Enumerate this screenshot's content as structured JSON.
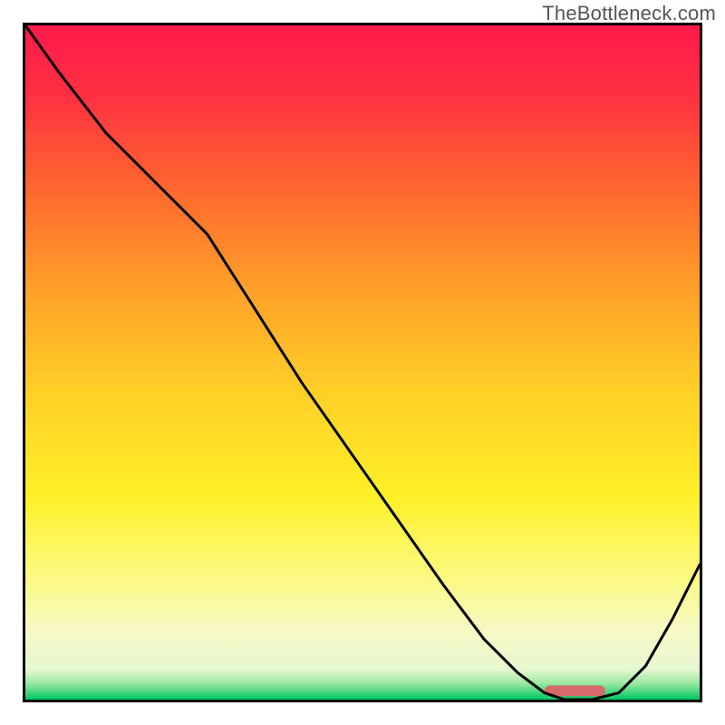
{
  "watermark": {
    "text": "TheBottleneck.com"
  },
  "chart_data": {
    "type": "line",
    "title": "",
    "xlabel": "",
    "ylabel": "",
    "xlim": [
      0,
      100
    ],
    "ylim": [
      0,
      100
    ],
    "grid": false,
    "gradient_stops": [
      {
        "offset": 0.0,
        "color": "#ff1a4b"
      },
      {
        "offset": 0.1,
        "color": "#ff2f42"
      },
      {
        "offset": 0.25,
        "color": "#ff6a2f"
      },
      {
        "offset": 0.4,
        "color": "#ffa329"
      },
      {
        "offset": 0.55,
        "color": "#ffd127"
      },
      {
        "offset": 0.7,
        "color": "#fff028"
      },
      {
        "offset": 0.82,
        "color": "#fbfa84"
      },
      {
        "offset": 0.9,
        "color": "#f6f9c6"
      },
      {
        "offset": 0.955,
        "color": "#e6f8d0"
      },
      {
        "offset": 0.975,
        "color": "#9fe9a2"
      },
      {
        "offset": 1.0,
        "color": "#00c762"
      }
    ],
    "series": [
      {
        "name": "bottleneck-curve",
        "color": "#000000",
        "stroke_width": 3,
        "x": [
          0,
          5,
          12,
          20,
          27,
          34,
          41,
          48,
          55,
          62,
          68,
          73,
          77,
          80,
          84,
          88,
          92,
          96,
          100
        ],
        "y": [
          100,
          93,
          84,
          76,
          69,
          58,
          47,
          37,
          27,
          17,
          9,
          4,
          1,
          0,
          0,
          1,
          5,
          12,
          20
        ]
      }
    ],
    "marker": {
      "name": "optimal-range",
      "x_start": 77,
      "x_end": 86,
      "y": 0.5,
      "height": 1.6,
      "color": "#d46a6a"
    }
  }
}
